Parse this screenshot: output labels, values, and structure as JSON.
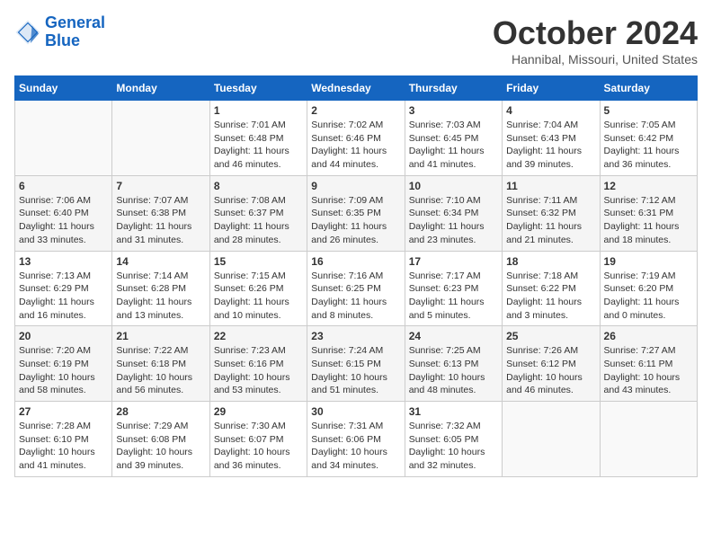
{
  "header": {
    "logo_line1": "General",
    "logo_line2": "Blue",
    "month": "October 2024",
    "location": "Hannibal, Missouri, United States"
  },
  "weekdays": [
    "Sunday",
    "Monday",
    "Tuesday",
    "Wednesday",
    "Thursday",
    "Friday",
    "Saturday"
  ],
  "weeks": [
    [
      {
        "day": "",
        "info": ""
      },
      {
        "day": "",
        "info": ""
      },
      {
        "day": "1",
        "info": "Sunrise: 7:01 AM\nSunset: 6:48 PM\nDaylight: 11 hours and 46 minutes."
      },
      {
        "day": "2",
        "info": "Sunrise: 7:02 AM\nSunset: 6:46 PM\nDaylight: 11 hours and 44 minutes."
      },
      {
        "day": "3",
        "info": "Sunrise: 7:03 AM\nSunset: 6:45 PM\nDaylight: 11 hours and 41 minutes."
      },
      {
        "day": "4",
        "info": "Sunrise: 7:04 AM\nSunset: 6:43 PM\nDaylight: 11 hours and 39 minutes."
      },
      {
        "day": "5",
        "info": "Sunrise: 7:05 AM\nSunset: 6:42 PM\nDaylight: 11 hours and 36 minutes."
      }
    ],
    [
      {
        "day": "6",
        "info": "Sunrise: 7:06 AM\nSunset: 6:40 PM\nDaylight: 11 hours and 33 minutes."
      },
      {
        "day": "7",
        "info": "Sunrise: 7:07 AM\nSunset: 6:38 PM\nDaylight: 11 hours and 31 minutes."
      },
      {
        "day": "8",
        "info": "Sunrise: 7:08 AM\nSunset: 6:37 PM\nDaylight: 11 hours and 28 minutes."
      },
      {
        "day": "9",
        "info": "Sunrise: 7:09 AM\nSunset: 6:35 PM\nDaylight: 11 hours and 26 minutes."
      },
      {
        "day": "10",
        "info": "Sunrise: 7:10 AM\nSunset: 6:34 PM\nDaylight: 11 hours and 23 minutes."
      },
      {
        "day": "11",
        "info": "Sunrise: 7:11 AM\nSunset: 6:32 PM\nDaylight: 11 hours and 21 minutes."
      },
      {
        "day": "12",
        "info": "Sunrise: 7:12 AM\nSunset: 6:31 PM\nDaylight: 11 hours and 18 minutes."
      }
    ],
    [
      {
        "day": "13",
        "info": "Sunrise: 7:13 AM\nSunset: 6:29 PM\nDaylight: 11 hours and 16 minutes."
      },
      {
        "day": "14",
        "info": "Sunrise: 7:14 AM\nSunset: 6:28 PM\nDaylight: 11 hours and 13 minutes."
      },
      {
        "day": "15",
        "info": "Sunrise: 7:15 AM\nSunset: 6:26 PM\nDaylight: 11 hours and 10 minutes."
      },
      {
        "day": "16",
        "info": "Sunrise: 7:16 AM\nSunset: 6:25 PM\nDaylight: 11 hours and 8 minutes."
      },
      {
        "day": "17",
        "info": "Sunrise: 7:17 AM\nSunset: 6:23 PM\nDaylight: 11 hours and 5 minutes."
      },
      {
        "day": "18",
        "info": "Sunrise: 7:18 AM\nSunset: 6:22 PM\nDaylight: 11 hours and 3 minutes."
      },
      {
        "day": "19",
        "info": "Sunrise: 7:19 AM\nSunset: 6:20 PM\nDaylight: 11 hours and 0 minutes."
      }
    ],
    [
      {
        "day": "20",
        "info": "Sunrise: 7:20 AM\nSunset: 6:19 PM\nDaylight: 10 hours and 58 minutes."
      },
      {
        "day": "21",
        "info": "Sunrise: 7:22 AM\nSunset: 6:18 PM\nDaylight: 10 hours and 56 minutes."
      },
      {
        "day": "22",
        "info": "Sunrise: 7:23 AM\nSunset: 6:16 PM\nDaylight: 10 hours and 53 minutes."
      },
      {
        "day": "23",
        "info": "Sunrise: 7:24 AM\nSunset: 6:15 PM\nDaylight: 10 hours and 51 minutes."
      },
      {
        "day": "24",
        "info": "Sunrise: 7:25 AM\nSunset: 6:13 PM\nDaylight: 10 hours and 48 minutes."
      },
      {
        "day": "25",
        "info": "Sunrise: 7:26 AM\nSunset: 6:12 PM\nDaylight: 10 hours and 46 minutes."
      },
      {
        "day": "26",
        "info": "Sunrise: 7:27 AM\nSunset: 6:11 PM\nDaylight: 10 hours and 43 minutes."
      }
    ],
    [
      {
        "day": "27",
        "info": "Sunrise: 7:28 AM\nSunset: 6:10 PM\nDaylight: 10 hours and 41 minutes."
      },
      {
        "day": "28",
        "info": "Sunrise: 7:29 AM\nSunset: 6:08 PM\nDaylight: 10 hours and 39 minutes."
      },
      {
        "day": "29",
        "info": "Sunrise: 7:30 AM\nSunset: 6:07 PM\nDaylight: 10 hours and 36 minutes."
      },
      {
        "day": "30",
        "info": "Sunrise: 7:31 AM\nSunset: 6:06 PM\nDaylight: 10 hours and 34 minutes."
      },
      {
        "day": "31",
        "info": "Sunrise: 7:32 AM\nSunset: 6:05 PM\nDaylight: 10 hours and 32 minutes."
      },
      {
        "day": "",
        "info": ""
      },
      {
        "day": "",
        "info": ""
      }
    ]
  ]
}
